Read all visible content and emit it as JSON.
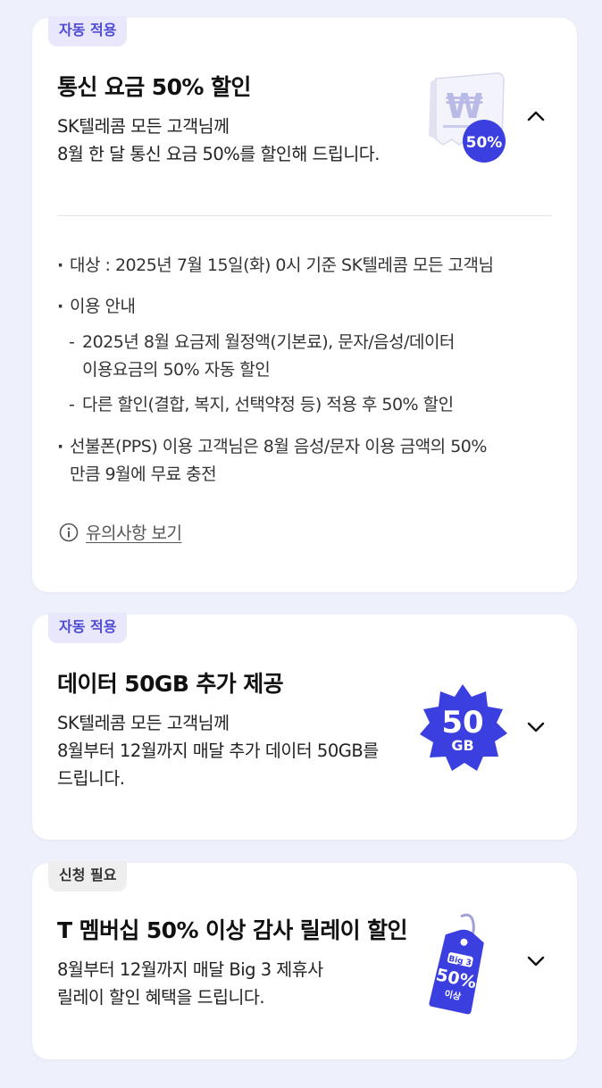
{
  "cards": [
    {
      "tag": "자동 적용",
      "title": "통신 요금 50% 할인",
      "desc": [
        "SK텔레콤 모든 고객님께",
        "8월 한 달 통신 요금 50%를 할인해 드립니다."
      ],
      "badge": "50%",
      "icon": "won-receipt-50-icon",
      "expanded": true,
      "details": {
        "target": "대상 : 2025년 7월 15일(화) 0시 기준 SK텔레콤 모든 고객님",
        "usage_title": "이용 안내",
        "usage_items": [
          [
            "2025년 8월 요금제 월정액(기본료), 문자/음성/데이터",
            "이용요금의 50% 자동 할인"
          ],
          [
            "다른 할인(결합, 복지, 선택약정 등) 적용 후 50% 할인"
          ]
        ],
        "prepaid": [
          "선불폰(PPS) 이용 고객님은 8월 음성/문자 이용 금액의 50%",
          "만큼 9월에 무료 충전"
        ],
        "notice_link": "유의사항 보기"
      }
    },
    {
      "tag": "자동 적용",
      "title": "데이터 50GB 추가 제공",
      "desc": [
        "SK텔레콤 모든 고객님께",
        "8월부터 12월까지 매달 추가 데이터 50GB를",
        "드립니다."
      ],
      "badge_value": "50",
      "badge_unit": "GB",
      "icon": "data-50gb-badge-icon",
      "expanded": false
    },
    {
      "tag": "신청 필요",
      "title": "T 멤버십 50% 이상 감사 릴레이 할인",
      "desc": [
        "8월부터 12월까지 매달 Big 3 제휴사",
        "릴레이 할인 혜택을 드립니다."
      ],
      "badge_top": "Big 3",
      "badge_value": "50%",
      "badge_bottom": "이상",
      "icon": "price-tag-icon",
      "expanded": false
    }
  ],
  "colors": {
    "page_bg": "#eef0fb",
    "accent": "#4f4bd4",
    "badge_blue": "#3b3fe0"
  }
}
